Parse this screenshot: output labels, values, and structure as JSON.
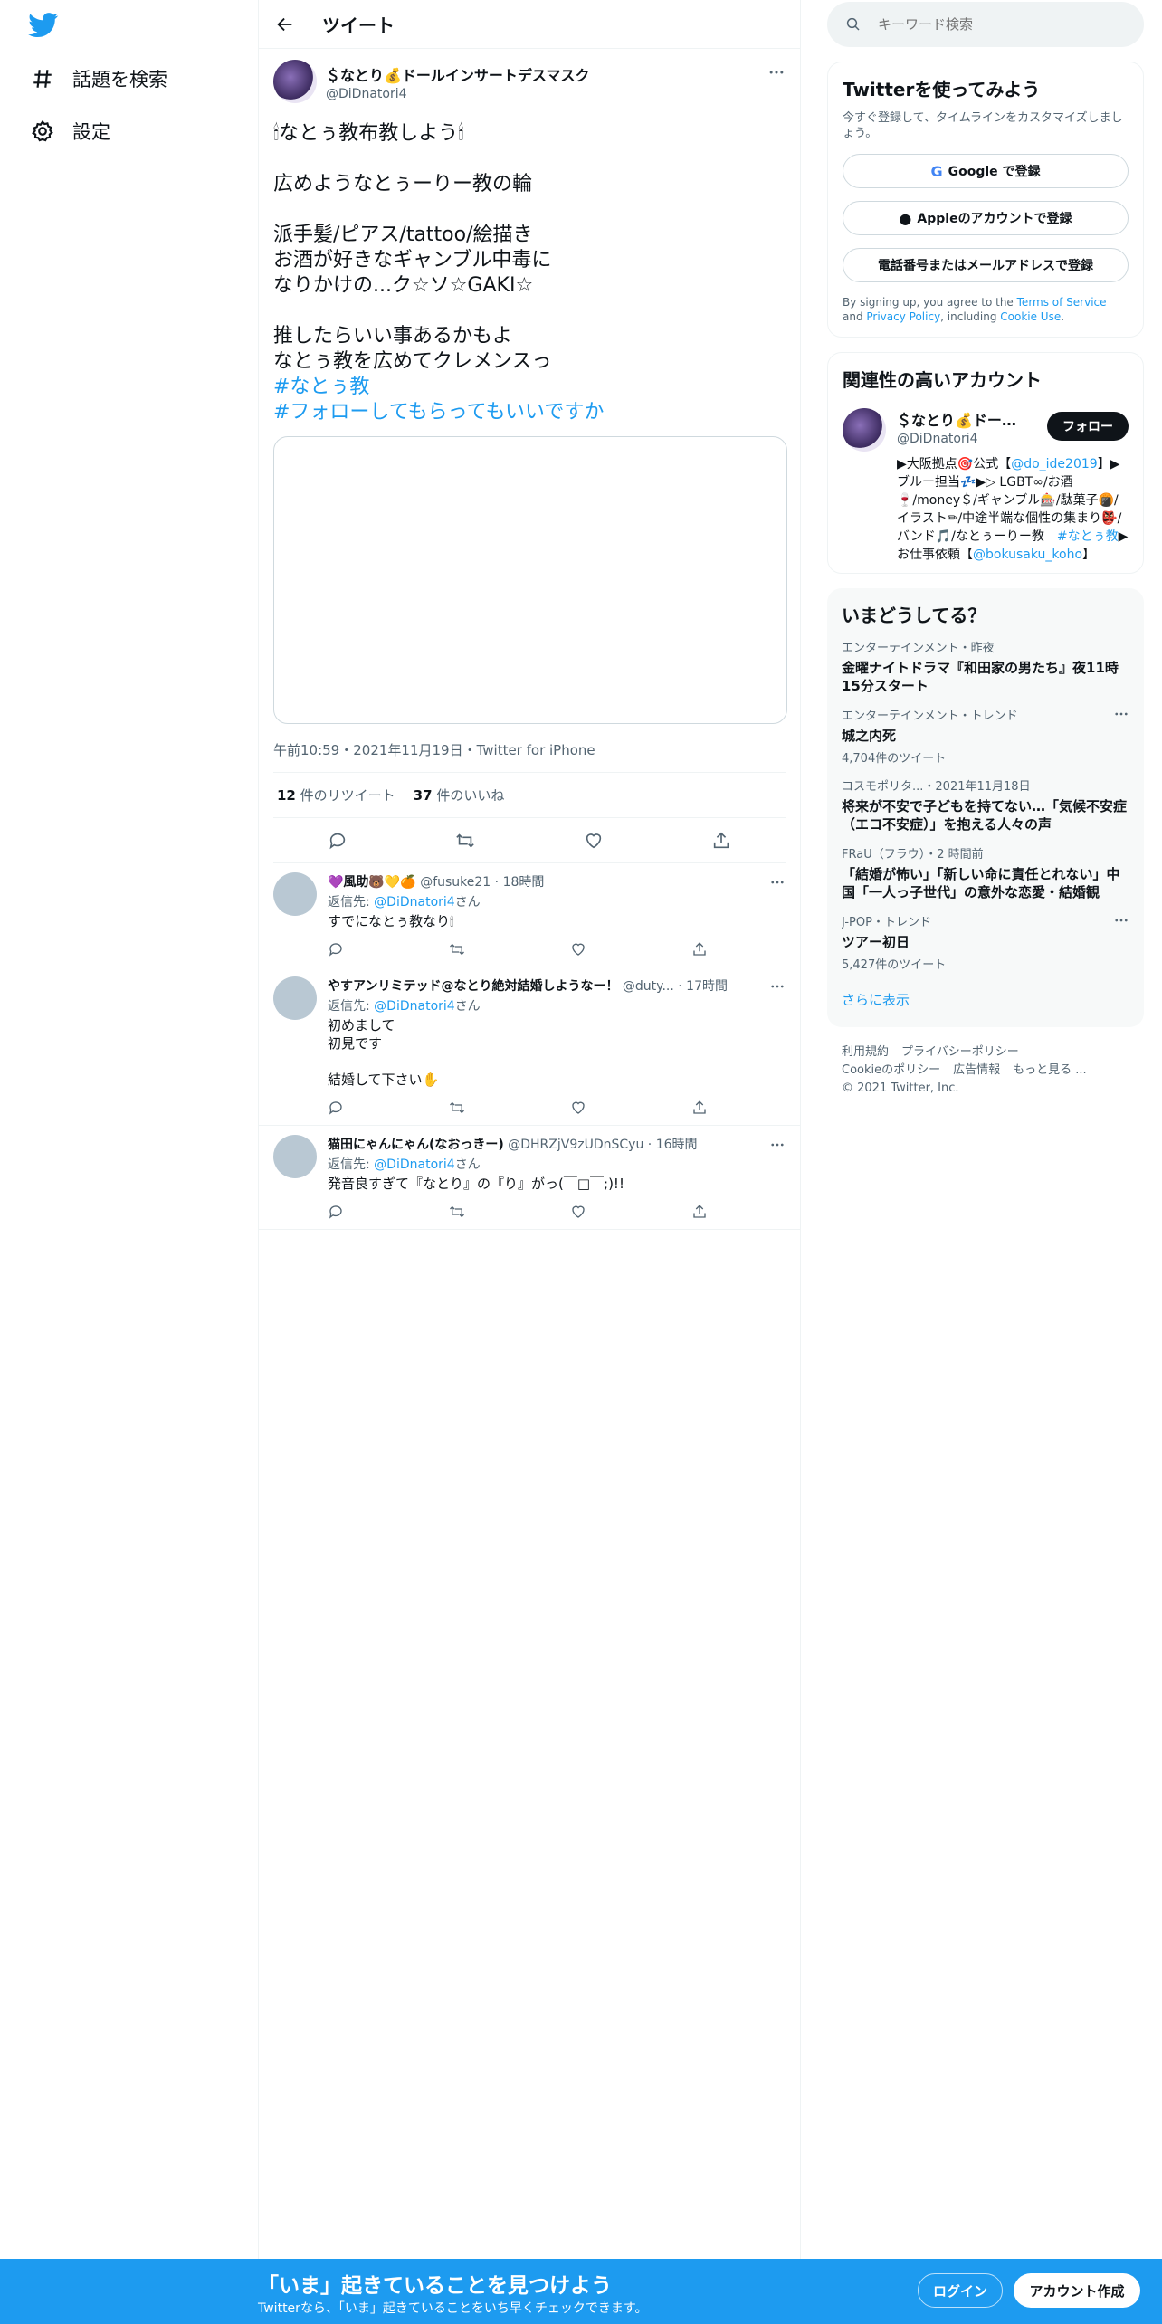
{
  "nav": {
    "logo": "twitter-bird-icon",
    "items": [
      {
        "icon": "hashtag-icon",
        "label": "話題を検索"
      },
      {
        "icon": "gear-icon",
        "label": "設定"
      }
    ]
  },
  "header": {
    "title": "ツイート"
  },
  "tweet": {
    "author_name": "＄なとり💰ドールインサートデスマスク",
    "author_handle": "@DiDnatori4",
    "text": "🕯なとぅ教布教しよう🕯\n\n広めようなとぅーりー教の輪\n\n派手髪/ピアス/tattoo/絵描き\nお酒が好きなギャンブル中毒に\nなりかけの...ク☆ソ☆GAKI☆\n\n推したらいい事あるかもよ\nなとぅ教を広めてクレメンスっ",
    "hashtags": [
      "#なとぅ教",
      "#フォローしてもらってもいいですか"
    ],
    "meta": "午前10:59・2021年11月19日・Twitter for iPhone",
    "retweets": "12",
    "retweets_label": "件のリツイート",
    "likes": "37",
    "likes_label": "件のいいね"
  },
  "replies": [
    {
      "name": "💜風助🐻💛🍊",
      "handle": "@fusuke21",
      "time": "18時間",
      "reply_to_prefix": "返信先: ",
      "reply_to": "@DiDnatori4",
      "reply_to_suffix": "さん",
      "text": "すでになとぅ教なり🕯"
    },
    {
      "name": "やすアンリミテッド@なとり絶対結婚しようなー！",
      "handle": "@duty...",
      "time": "17時間",
      "reply_to_prefix": "返信先: ",
      "reply_to": "@DiDnatori4",
      "reply_to_suffix": "さん",
      "text": "初めまして\n初見です\n\n結婚して下さい✋"
    },
    {
      "name": "猫田にゃんにゃん(なおっきー)",
      "handle": "@DHRZjV9zUDnSCyu",
      "time": "16時間",
      "reply_to_prefix": "返信先: ",
      "reply_to": "@DiDnatori4",
      "reply_to_suffix": "さん",
      "text": "発音良すぎて『なとり』の『り』がっ(￣□￣;)!!"
    }
  ],
  "search": {
    "placeholder": "キーワード検索"
  },
  "signup": {
    "title": "Twitterを使ってみよう",
    "desc": "今すぐ登録して、タイムラインをカスタマイズしましょう。",
    "google": "Google で登録",
    "apple": "Appleのアカウントで登録",
    "phone": "電話番号またはメールアドレスで登録",
    "legal_1": "By signing up, you agree to the ",
    "terms": "Terms of Service",
    "legal_2": " and ",
    "privacy": "Privacy Policy",
    "legal_3": ", including ",
    "cookie": "Cookie Use",
    "legal_4": "."
  },
  "related": {
    "title": "関連性の高いアカウント",
    "name": "＄なとり💰ドールインサートデスマスク",
    "handle": "@DiDnatori4",
    "follow": "フォロー",
    "bio_1": "▶大阪拠点🎯公式【",
    "bio_link1": "@do_ide2019",
    "bio_2": "】▶ブルー担当💤▶▷ LGBT∞/お酒🍷/money＄/ギャンブル🎰/駄菓子🍘/イラスト✏/中途半端な個性の集まり👺/バンド🎵/なとぅーりー教　",
    "bio_link2": "#なとぅ教",
    "bio_3": "▶ お仕事依頼【",
    "bio_link3": "@bokusaku_koho",
    "bio_4": "】"
  },
  "trends": {
    "title": "いまどうしてる？",
    "items": [
      {
        "meta": "エンターテインメント・昨夜",
        "title": "金曜ナイトドラマ『和田家の男たち』夜11時15分スタート",
        "count": ""
      },
      {
        "meta": "エンターテインメント・トレンド",
        "title": "城之内死",
        "count": "4,704件のツイート"
      },
      {
        "meta": "コスモポリタ...・2021年11月18日",
        "title": "将来が不安で子どもを持てない…「気候不安症（エコ不安症）」を抱える人々の声",
        "count": ""
      },
      {
        "meta": "FRaU（フラウ）・2 時間前",
        "title": "「結婚が怖い」「新しい命に責任とれない」中国「一人っ子世代」の意外な恋愛・結婚観",
        "count": ""
      },
      {
        "meta": "J-POP・トレンド",
        "title": "ツアー初日",
        "count": "5,427件のツイート"
      }
    ],
    "show_more": "さらに表示"
  },
  "footer": {
    "links": [
      "利用規約",
      "プライバシーポリシー",
      "Cookieのポリシー",
      "広告情報",
      "もっと見る ..."
    ],
    "copyright": "© 2021 Twitter, Inc."
  },
  "bottom_bar": {
    "title": "「いま」起きていることを見つけよう",
    "subtitle": "Twitterなら、「いま」起きていることをいち早くチェックできます。",
    "login": "ログイン",
    "signup": "アカウント作成"
  }
}
